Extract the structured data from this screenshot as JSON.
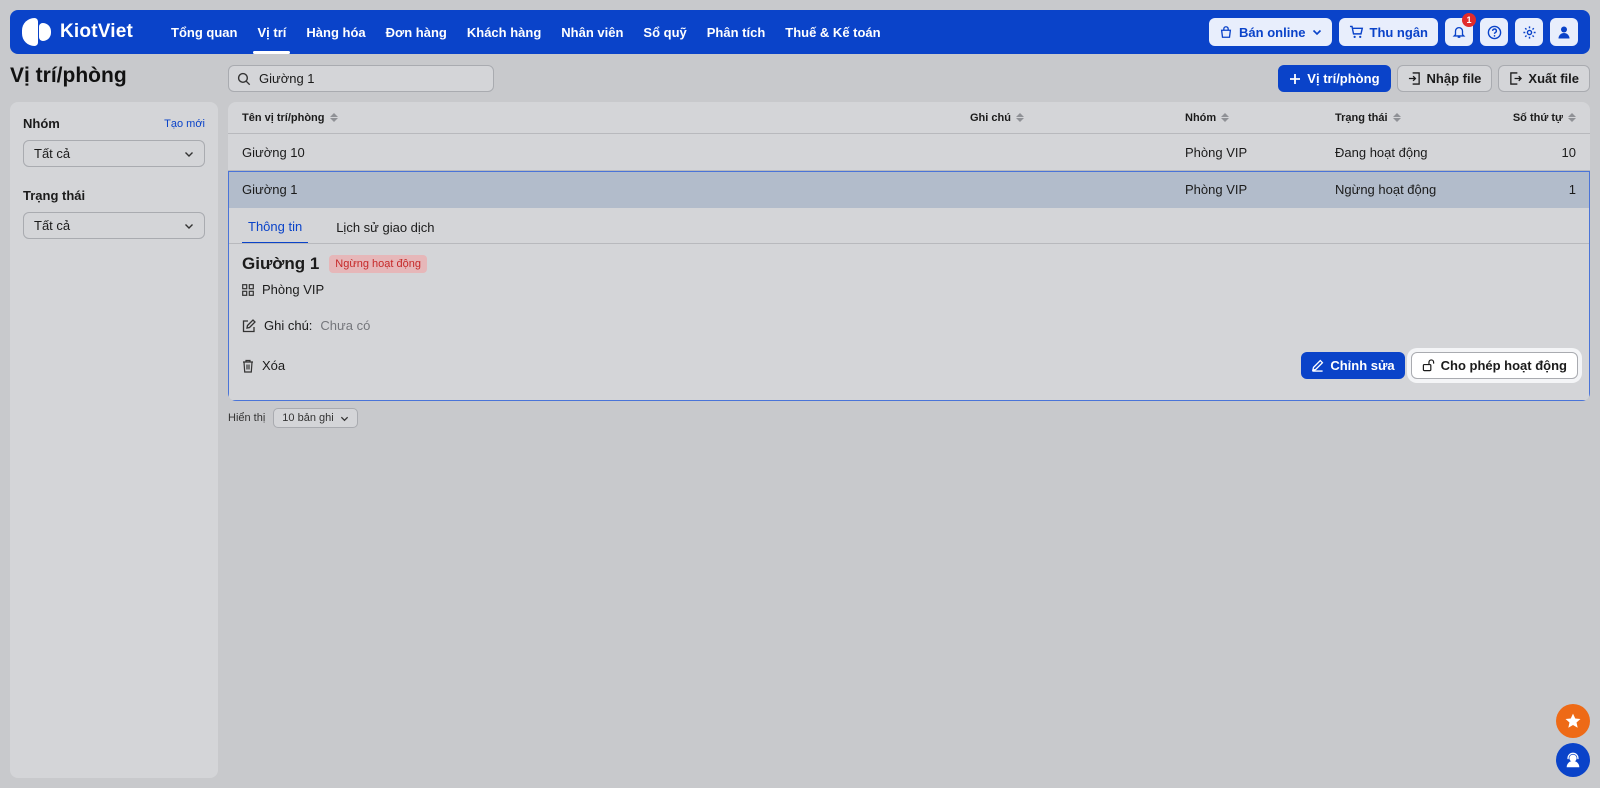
{
  "brand": {
    "name": "KiotViet"
  },
  "nav": {
    "items": [
      {
        "label": "Tổng quan",
        "active": false
      },
      {
        "label": "Vị trí",
        "active": true
      },
      {
        "label": "Hàng hóa",
        "active": false
      },
      {
        "label": "Đơn hàng",
        "active": false
      },
      {
        "label": "Khách hàng",
        "active": false
      },
      {
        "label": "Nhân viên",
        "active": false
      },
      {
        "label": "Sổ quỹ",
        "active": false
      },
      {
        "label": "Phân tích",
        "active": false
      },
      {
        "label": "Thuế & Kế toán",
        "active": false
      }
    ],
    "online_label": "Bán online",
    "cashier_label": "Thu ngân",
    "notification_count": "1"
  },
  "page": {
    "title": "Vị trí/phòng",
    "search_value": "Giường 1",
    "add_label": "Vị trí/phòng",
    "import_label": "Nhập file",
    "export_label": "Xuất file"
  },
  "sidebar": {
    "group_title": "Nhóm",
    "group_create": "Tạo mới",
    "group_value": "Tất cả",
    "status_title": "Trạng thái",
    "status_value": "Tất cả"
  },
  "table": {
    "headers": [
      "Tên vị trí/phòng",
      "Ghi chú",
      "Nhóm",
      "Trạng thái",
      "Số thứ tự"
    ],
    "rows": [
      {
        "name": "Giường 10",
        "note": "",
        "group": "Phòng VIP",
        "status": "Đang hoạt động",
        "order": "10"
      },
      {
        "name": "Giường 1",
        "note": "",
        "group": "Phòng VIP",
        "status": "Ngừng hoạt động",
        "order": "1"
      }
    ]
  },
  "detail": {
    "tabs": [
      "Thông tin",
      "Lịch sử giao dịch"
    ],
    "name": "Giường 1",
    "status_badge": "Ngừng hoạt động",
    "group": "Phòng VIP",
    "note_label": "Ghi chú:",
    "note_value": "Chưa có",
    "delete_label": "Xóa",
    "edit_label": "Chỉnh sửa",
    "activate_label": "Cho phép hoạt động"
  },
  "pager": {
    "label": "Hiển thị",
    "page_size": "10 bản ghi"
  },
  "colors": {
    "brand": "#0a43c9",
    "danger": "#c62828",
    "fab_orange": "#ee6a16"
  }
}
